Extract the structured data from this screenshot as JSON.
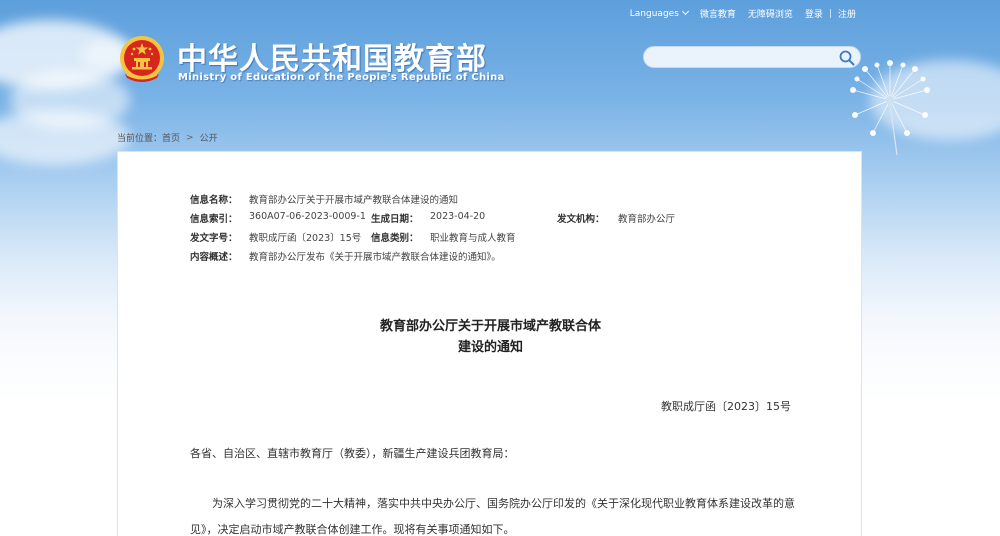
{
  "top_links": {
    "languages": "Languages",
    "weibo": "微言教育",
    "accessible": "无障碍浏览",
    "login": "登录",
    "register": "注册"
  },
  "header": {
    "title_cn": "中华人民共和国教育部",
    "title_en": "Ministry of Education of the People's Republic of China"
  },
  "search": {
    "value": "",
    "placeholder": ""
  },
  "breadcrumb": {
    "prefix": "当前位置：",
    "home": "首页",
    "separator": ">",
    "current": "公开"
  },
  "meta": {
    "name_label": "信息名称：",
    "name_value": "教育部办公厅关于开展市域产教联合体建设的通知",
    "index_label": "信息索引：",
    "index_value": "360A07-06-2023-0009-1",
    "date_label": "生成日期：",
    "date_value": "2023-04-20",
    "issuer_label": "发文机构：",
    "issuer_value": "教育部办公厅",
    "docno_label": "发文字号：",
    "docno_value": "教职成厅函〔2023〕15号",
    "category_label": "信息类别：",
    "category_value": "职业教育与成人教育",
    "summary_label": "内容概述：",
    "summary_value": "教育部办公厅发布《关于开展市域产教联合体建设的通知》。"
  },
  "document": {
    "title_line1": "教育部办公厅关于开展市域产教联合体",
    "title_line2": "建设的通知",
    "doc_number": "教职成厅函〔2023〕15号",
    "salutation": "各省、自治区、直辖市教育厅（教委），新疆生产建设兵团教育局：",
    "paragraph1": "为深入学习贯彻党的二十大精神，落实中共中央办公厅、国务院办公厅印发的《关于深化现代职业教育体系建设改革的意见》，决定启动市域产教联合体创建工作。现将有关事项通知如下。"
  },
  "colors": {
    "sky_top": "#5d9fdc",
    "emblem_red": "#d7261e",
    "emblem_gold": "#f5c542"
  }
}
